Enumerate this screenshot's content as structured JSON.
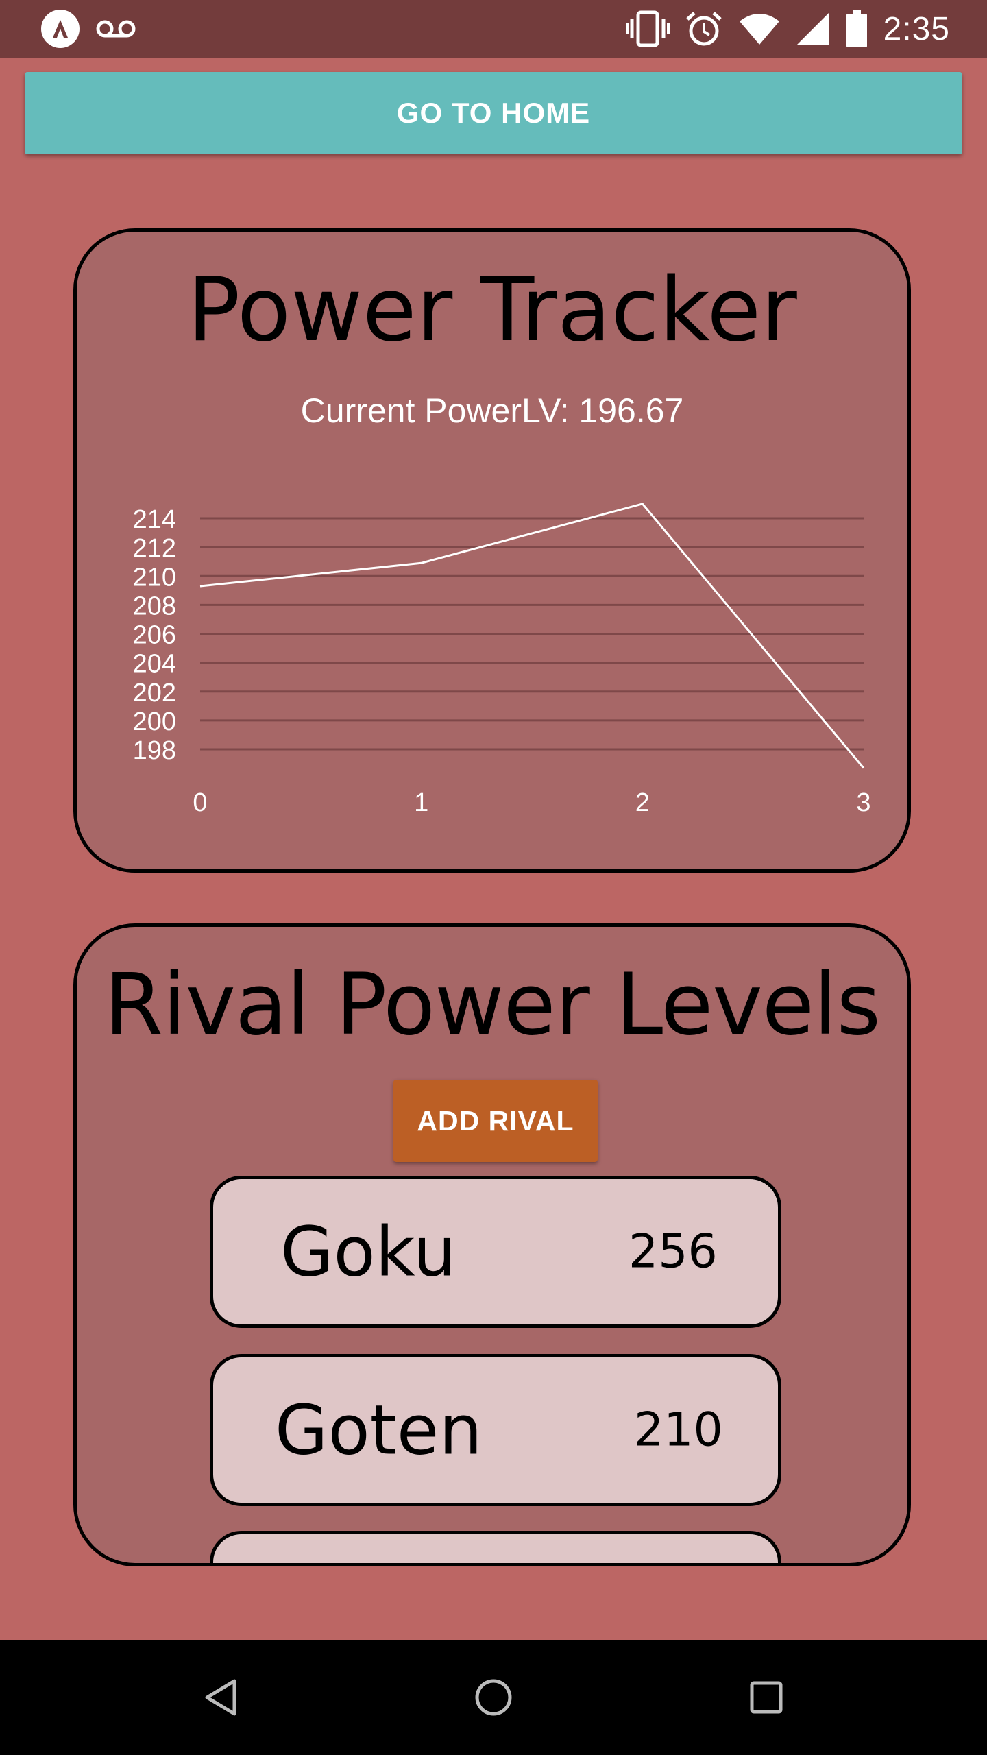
{
  "status_bar": {
    "clock": "2:35",
    "icons": [
      "app-logo-icon",
      "voicemail-icon",
      "vibrate-icon",
      "alarm-icon",
      "wifi-icon",
      "signal-icon",
      "battery-icon"
    ]
  },
  "home_button": {
    "label": "GO TO HOME",
    "color": "#65bcbb"
  },
  "tracker": {
    "title": "Power Tracker",
    "current_label": "Current PowerLV:",
    "current_value": "196.67"
  },
  "chart_data": {
    "type": "line",
    "x": [
      0,
      1,
      2,
      3
    ],
    "y": [
      209.3,
      210.9,
      215.0,
      196.7
    ],
    "xticks": [
      "0",
      "1",
      "2",
      "3"
    ],
    "yticks": [
      "198",
      "200",
      "202",
      "204",
      "206",
      "208",
      "210",
      "212",
      "214"
    ],
    "ylim": [
      198,
      214
    ],
    "grid": true,
    "line_color": "#ffffff"
  },
  "rivals": {
    "title": "Rival Power Levels",
    "add_label": "ADD RIVAL",
    "items": [
      {
        "name": "Goku",
        "value": "256"
      },
      {
        "name": "Goten",
        "value": "210"
      },
      {
        "name": "",
        "value": ""
      }
    ]
  },
  "nav_bar": {
    "icons": [
      "back-icon",
      "home-icon",
      "recents-icon"
    ]
  },
  "colors": {
    "background": "#bc6664",
    "card": "#a76767",
    "status_bar": "#733c3c",
    "add_rival": "#bc5f25",
    "rival_item": "#dfc6c7"
  }
}
